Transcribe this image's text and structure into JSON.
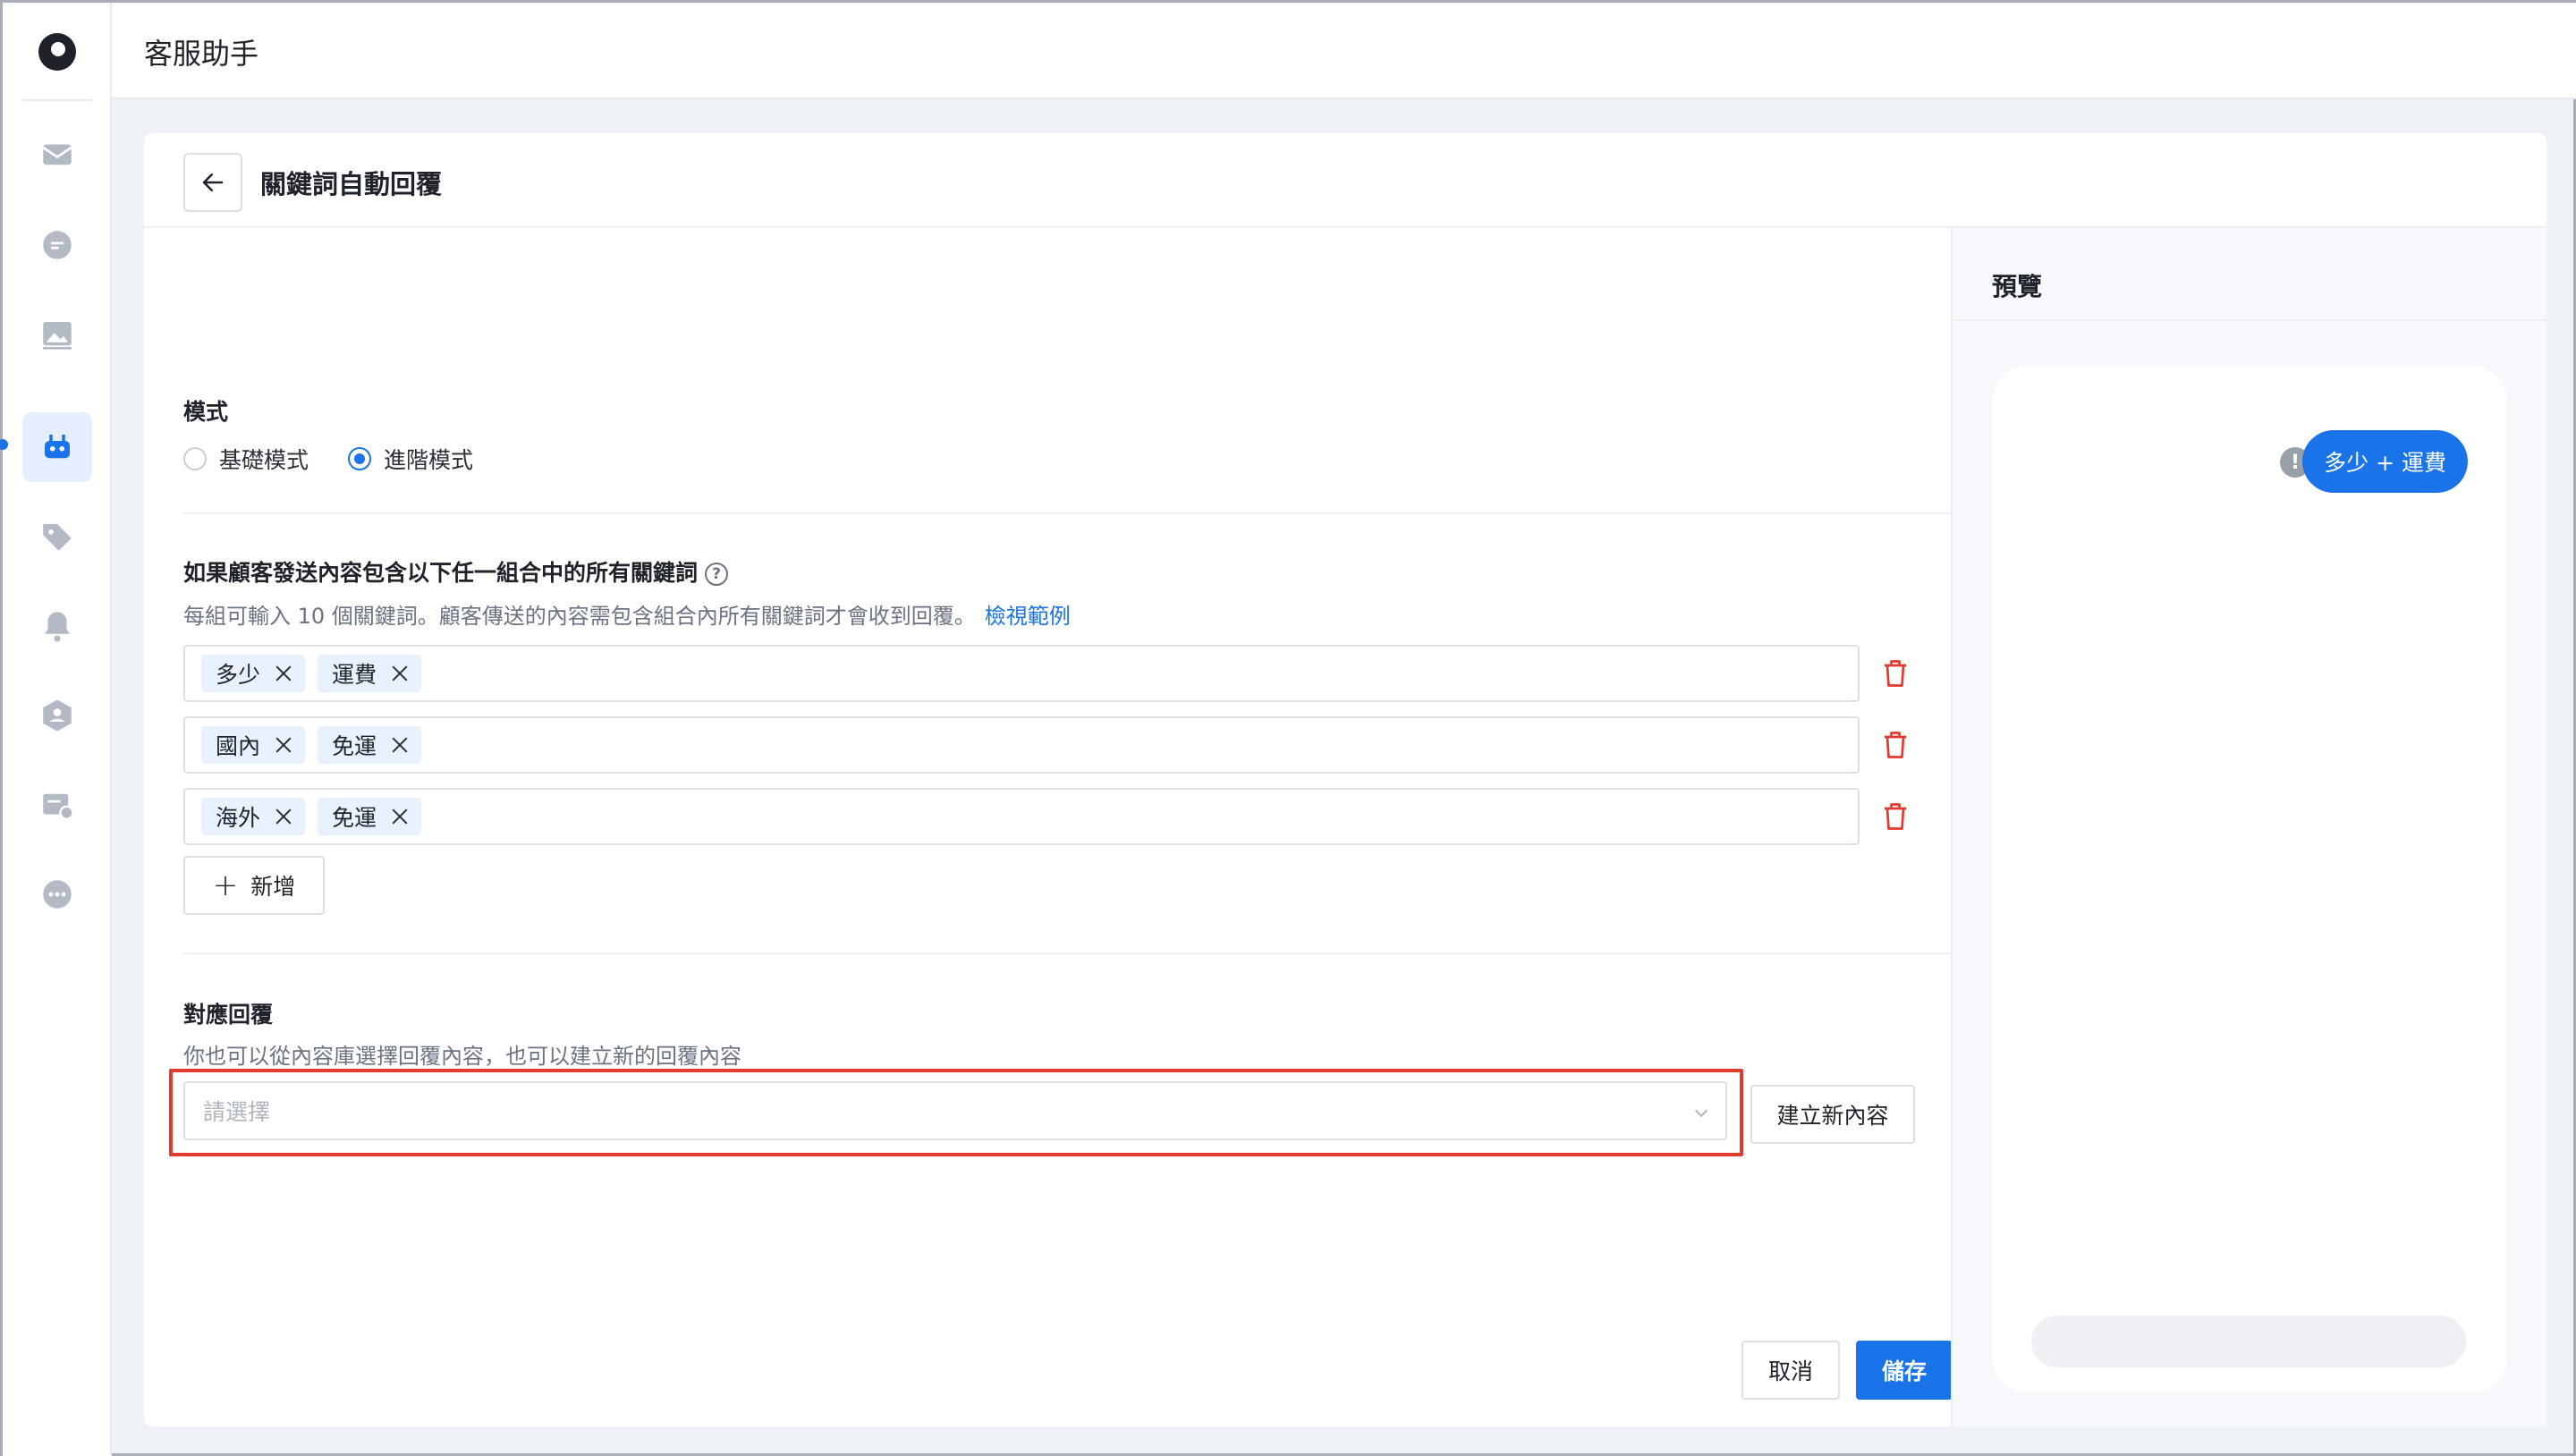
{
  "app": {
    "title": "客服助手"
  },
  "page": {
    "title": "關鍵詞自動回覆"
  },
  "mode": {
    "label": "模式",
    "options": [
      "基礎模式",
      "進階模式"
    ],
    "selected": "進階模式"
  },
  "keywords": {
    "title": "如果顧客發送內容包含以下任一組合中的所有關鍵詞",
    "help": "?",
    "description": "每組可輸入 10 個關鍵詞。顧客傳送的內容需包含組合內所有關鍵詞才會收到回覆。",
    "example_link": "檢視範例",
    "groups": [
      [
        "多少",
        "運費"
      ],
      [
        "國內",
        "免運"
      ],
      [
        "海外",
        "免運"
      ]
    ],
    "add_label": "新增",
    "add_symbol": "+"
  },
  "reply": {
    "title": "對應回覆",
    "description": "你也可以從內容庫選擇回覆內容，也可以建立新的回覆內容",
    "select_placeholder": "請選擇",
    "create_label": "建立新內容"
  },
  "actions": {
    "cancel": "取消",
    "save": "儲存"
  },
  "preview": {
    "title": "預覽",
    "bubble": "多少 + 運費",
    "warning": "!"
  },
  "colors": {
    "accent": "#1a73e8",
    "danger": "#e23a2e",
    "tag_bg": "#e8f1fd"
  },
  "sidebar": {
    "items": [
      "inbox-icon",
      "chat-icon",
      "image-icon",
      "bot-icon",
      "tag-icon",
      "bell-icon",
      "team-icon",
      "ticket-icon",
      "more-icon"
    ],
    "active": "bot-icon"
  }
}
